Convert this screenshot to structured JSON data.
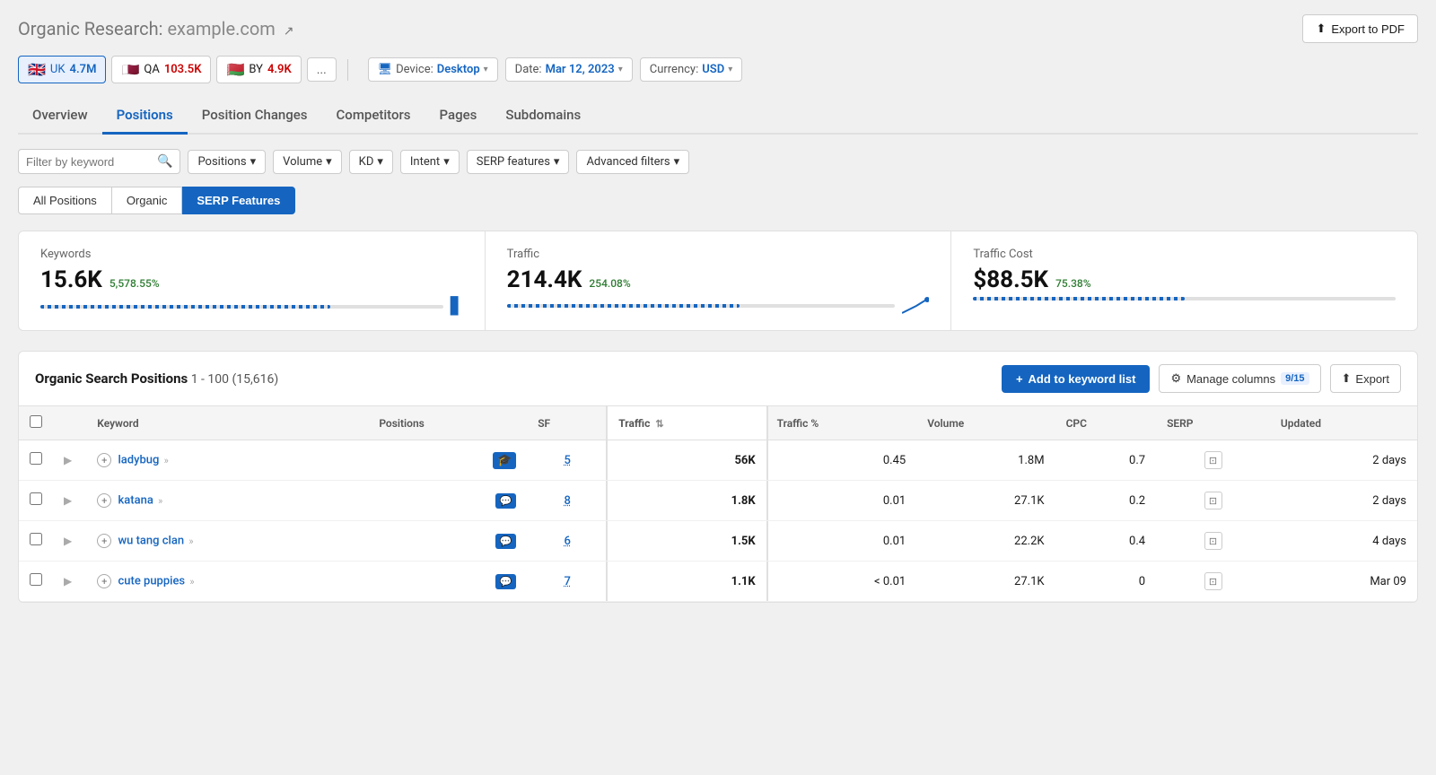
{
  "page": {
    "title": "Organic Research:",
    "domain": "example.com",
    "export_btn": "Export to PDF"
  },
  "regions": [
    {
      "id": "uk",
      "flag": "🇬🇧",
      "label": "UK",
      "count": "4.7M",
      "active": true
    },
    {
      "id": "qa",
      "flag": "🇶🇦",
      "label": "QA",
      "count": "103.5K",
      "active": false
    },
    {
      "id": "by",
      "flag": "🇧🇾",
      "label": "BY",
      "count": "4.9K",
      "active": false
    }
  ],
  "more_regions": "...",
  "device": {
    "label": "Device:",
    "value": "Desktop",
    "icon": "desktop-icon"
  },
  "date": {
    "label": "Date:",
    "value": "Mar 12, 2023"
  },
  "currency": {
    "label": "Currency:",
    "value": "USD"
  },
  "nav_tabs": [
    {
      "id": "overview",
      "label": "Overview"
    },
    {
      "id": "positions",
      "label": "Positions",
      "active": true
    },
    {
      "id": "position_changes",
      "label": "Position Changes"
    },
    {
      "id": "competitors",
      "label": "Competitors"
    },
    {
      "id": "pages",
      "label": "Pages"
    },
    {
      "id": "subdomains",
      "label": "Subdomains"
    }
  ],
  "filters": {
    "keyword_placeholder": "Filter by keyword",
    "positions_label": "Positions",
    "volume_label": "Volume",
    "kd_label": "KD",
    "intent_label": "Intent",
    "serp_label": "SERP features",
    "advanced_label": "Advanced filters"
  },
  "sub_tabs": [
    {
      "id": "all",
      "label": "All Positions"
    },
    {
      "id": "organic",
      "label": "Organic"
    },
    {
      "id": "serp",
      "label": "SERP Features",
      "active": true
    }
  ],
  "stats": {
    "keywords": {
      "label": "Keywords",
      "value": "15.6K",
      "change": "5,578.55%",
      "bar_pct": 72
    },
    "traffic": {
      "label": "Traffic",
      "value": "214.4K",
      "change": "254.08%",
      "bar_type": "line"
    },
    "traffic_cost": {
      "label": "Traffic Cost",
      "value": "$88.5K",
      "change": "75.38%"
    }
  },
  "table": {
    "title": "Organic Search Positions",
    "range": "1 - 100 (15,616)",
    "add_keyword_btn": "Add to keyword list",
    "manage_cols_btn": "Manage columns",
    "manage_cols_badge": "9/15",
    "export_btn": "Export",
    "columns": [
      {
        "id": "keyword",
        "label": "Keyword"
      },
      {
        "id": "positions",
        "label": "Positions"
      },
      {
        "id": "sf",
        "label": "SF"
      },
      {
        "id": "traffic",
        "label": "Traffic",
        "sorted": true
      },
      {
        "id": "traffic_pct",
        "label": "Traffic %"
      },
      {
        "id": "volume",
        "label": "Volume"
      },
      {
        "id": "cpc",
        "label": "CPC"
      },
      {
        "id": "serp",
        "label": "SERP"
      },
      {
        "id": "updated",
        "label": "Updated"
      }
    ],
    "rows": [
      {
        "keyword": "ladybug",
        "positions": "5",
        "sf_type": "graduation",
        "traffic": "56K",
        "traffic_pct": "0.45",
        "volume": "1.8M",
        "cpc": "0.7",
        "updated": "2 days"
      },
      {
        "keyword": "katana",
        "positions": "8",
        "sf_type": "chat",
        "traffic": "1.8K",
        "traffic_pct": "0.01",
        "volume": "27.1K",
        "cpc": "0.2",
        "updated": "2 days"
      },
      {
        "keyword": "wu tang clan",
        "positions": "6",
        "sf_type": "chat",
        "traffic": "1.5K",
        "traffic_pct": "0.01",
        "volume": "22.2K",
        "cpc": "0.4",
        "updated": "4 days"
      },
      {
        "keyword": "cute puppies",
        "positions": "7",
        "sf_type": "chat",
        "traffic": "1.1K",
        "traffic_pct": "< 0.01",
        "volume": "27.1K",
        "cpc": "0",
        "updated": "Mar 09"
      }
    ]
  },
  "icons": {
    "search": "🔍",
    "chevron_down": "▾",
    "external_link": "↗",
    "plus": "+",
    "upload": "↑",
    "gear": "⚙",
    "sort": "⇅",
    "expand": "▶"
  }
}
